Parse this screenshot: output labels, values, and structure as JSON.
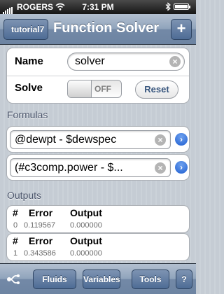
{
  "status_bar": {
    "carrier": "ROGERS",
    "time": "7:31 PM"
  },
  "nav": {
    "back_label": "tutorial7",
    "title": "Function Solver",
    "add_label": "+"
  },
  "form": {
    "name_label": "Name",
    "name_value": "solver",
    "solve_label": "Solve",
    "solve_state": "OFF",
    "reset_label": "Reset"
  },
  "formulas": {
    "header": "Formulas",
    "items": [
      "@dewpt - $dewspec",
      "(#c3comp.power - $..."
    ]
  },
  "outputs": {
    "header": "Outputs",
    "col_index": "#",
    "col_error": "Error",
    "col_output": "Output",
    "rows": [
      {
        "index": "0",
        "error": "0.119567",
        "output": "0.000000"
      },
      {
        "index": "1",
        "error": "0.343586",
        "output": "0.000000"
      }
    ]
  },
  "toolbar": {
    "fluids": "Fluids",
    "variables": "Variables",
    "tools": "Tools",
    "help": "?"
  },
  "icons": {
    "signal": "signal-bars-icon",
    "wifi": "wifi-icon",
    "bluetooth": "bluetooth-icon",
    "battery": "battery-icon",
    "clear": "clear-x-icon",
    "disclosure": "disclosure-arrow-icon",
    "toolbar_menu": "flow-diagram-icon"
  },
  "colors": {
    "nav_bar": "#7389a7",
    "background": "#c5ccd4",
    "disclosure": "#1f5fd1",
    "button_text": "#38567e"
  }
}
